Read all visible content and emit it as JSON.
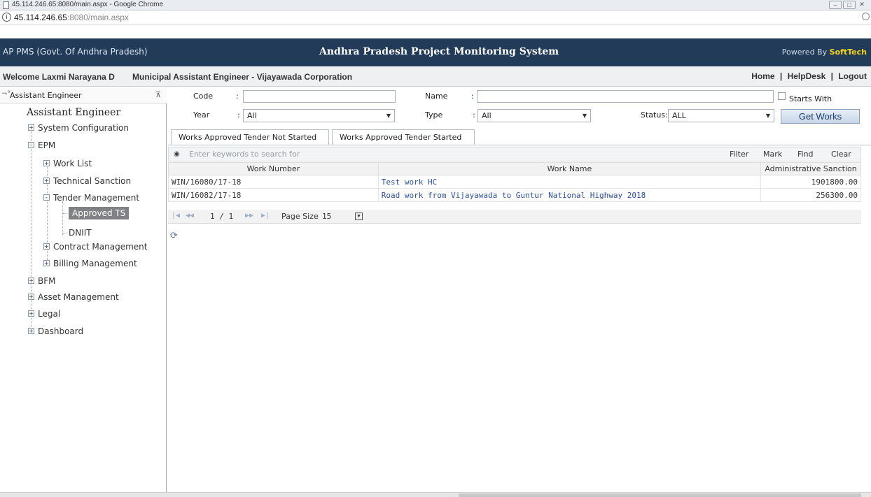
{
  "browser": {
    "window_title": "45.114.246.65:8080/main.aspx - Google Chrome",
    "url_host": "45.114.246.65",
    "url_rest": ":8080/main.aspx"
  },
  "header": {
    "left": "AP PMS (Govt. Of Andhra Pradesh)",
    "center": "Andhra Pradesh Project Monitoring System",
    "powered_prefix": "Powered By ",
    "powered_brand": "SoftTech",
    "brand_color": "#f3d21c",
    "background": "#213b58"
  },
  "welcome": {
    "user": "Welcome Laxmi Narayana D",
    "role": "Municipal Assistant Engineer - Vijayawada Corporation",
    "links": [
      "Home",
      "HelpDesk",
      "Logout"
    ],
    "separator": "|"
  },
  "sidebar": {
    "panel_title": "Assistant Engineer",
    "big_title": "Assistant Engineer",
    "items": [
      {
        "label": "System Configuration",
        "toggle": "+"
      },
      {
        "label": "EPM",
        "toggle": "-"
      },
      {
        "label": "Work List",
        "toggle": "+"
      },
      {
        "label": "Technical Sanction",
        "toggle": "+"
      },
      {
        "label": "Tender Management",
        "toggle": "-"
      },
      {
        "label": "Approved TS",
        "toggle": ""
      },
      {
        "label": "DNIIT",
        "toggle": ""
      },
      {
        "label": "Contract Management",
        "toggle": "+"
      },
      {
        "label": "Billing Management",
        "toggle": "+"
      },
      {
        "label": "BFM",
        "toggle": "+"
      },
      {
        "label": "Asset Management",
        "toggle": "+"
      },
      {
        "label": "Legal",
        "toggle": "+"
      },
      {
        "label": "Dashboard",
        "toggle": "+"
      }
    ],
    "selected": "Approved TS"
  },
  "filters": {
    "code_label": "Code",
    "name_label": "Name",
    "colon": ":",
    "code_value": "",
    "name_value": "",
    "starts_with_label": "Starts With",
    "year_label": "Year",
    "year_value": "All",
    "type_label": "Type",
    "type_value": "All",
    "status_label": "Status:",
    "status_value": "ALL",
    "get_works_label": "Get Works"
  },
  "tabs": [
    {
      "label": "Works Approved Tender Not Started",
      "active": true
    },
    {
      "label": "Works Approved Tender Started",
      "active": false
    }
  ],
  "grid": {
    "search_placeholder": "Enter keywords to search for",
    "toolbar": [
      "Filter",
      "Mark",
      "Find",
      "Clear"
    ],
    "columns": [
      "Work Number",
      "Work Name",
      "Administrative Sanction"
    ],
    "rows": [
      {
        "number": "WIN/16080/17-18",
        "name": "Test work HC",
        "amount": "1901800.00"
      },
      {
        "number": "WIN/16082/17-18",
        "name": "Road work from Vijayawada to Guntur National Highway 2018",
        "amount": "256300.00"
      }
    ],
    "pager": {
      "page_text": "1 / 1",
      "page_size_label": "Page Size",
      "page_size": "15"
    }
  }
}
